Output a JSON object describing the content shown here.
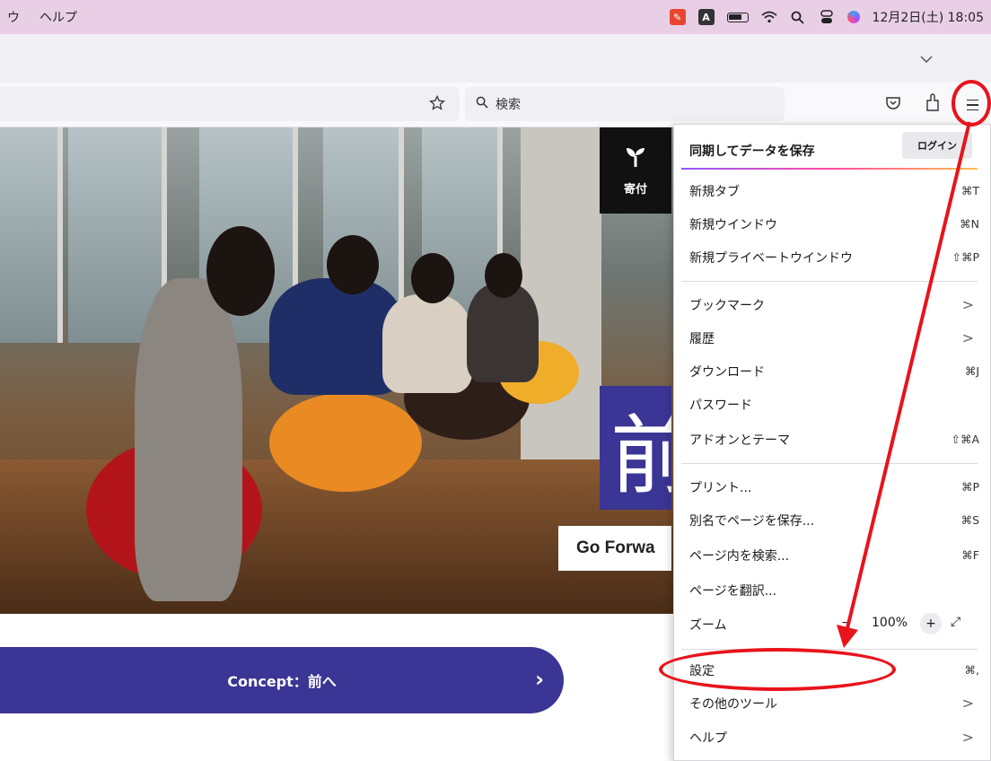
{
  "menubar": {
    "items": [
      "ウ",
      "ヘルプ"
    ],
    "clock": "12月2日(土) 18:05",
    "status_icons": [
      "app-icon",
      "input-method-icon",
      "battery-icon",
      "wifi-icon",
      "spotlight-search-icon",
      "control-center-icon",
      "siri-icon"
    ],
    "input_method_label": "A"
  },
  "toolbar": {
    "search_placeholder": "検索",
    "icons": [
      "bookmark-star-icon",
      "pocket-icon",
      "extensions-icon",
      "hamburger-menu-icon",
      "tab-list-chevron-icon"
    ]
  },
  "page": {
    "donate_label": "寄付",
    "kanji": "前",
    "go_forward_text": "Go Forwa",
    "concept_label": "Concept：前へ",
    "concept_chevron": "›"
  },
  "app_menu": {
    "sync_title": "同期してデータを保存",
    "login_label": "ログイン",
    "items": [
      {
        "label": "新規タブ",
        "shortcut": "⌘T"
      },
      {
        "label": "新規ウインドウ",
        "shortcut": "⌘N"
      },
      {
        "label": "新規プライベートウインドウ",
        "shortcut": "⇧⌘P"
      },
      {
        "label": "ブックマーク",
        "submenu": ">"
      },
      {
        "label": "履歴",
        "submenu": ">"
      },
      {
        "label": "ダウンロード",
        "shortcut": "⌘J"
      },
      {
        "label": "パスワード",
        "shortcut": ""
      },
      {
        "label": "アドオンとテーマ",
        "shortcut": "⇧⌘A"
      },
      {
        "label": "プリント...",
        "shortcut": "⌘P"
      },
      {
        "label": "別名でページを保存...",
        "shortcut": "⌘S"
      },
      {
        "label": "ページ内を検索...",
        "shortcut": "⌘F"
      },
      {
        "label": "ページを翻訳...",
        "shortcut": ""
      },
      {
        "label": "ズーム",
        "zoom_minus": "−",
        "zoom_value": "100%",
        "zoom_plus": "+",
        "fullscreen": "⤢"
      },
      {
        "label": "設定",
        "shortcut": "⌘,"
      },
      {
        "label": "その他のツール",
        "submenu": ">"
      },
      {
        "label": "ヘルプ",
        "submenu": ">"
      }
    ]
  },
  "annotations": {
    "color": "#e8131b",
    "highlighted": [
      "hamburger-menu-button",
      "settings-menu-item"
    ]
  },
  "colors": {
    "menubar_bg": "#e9cfe6",
    "brand_purple": "#3b3595",
    "annotation_red": "#e8131b"
  }
}
